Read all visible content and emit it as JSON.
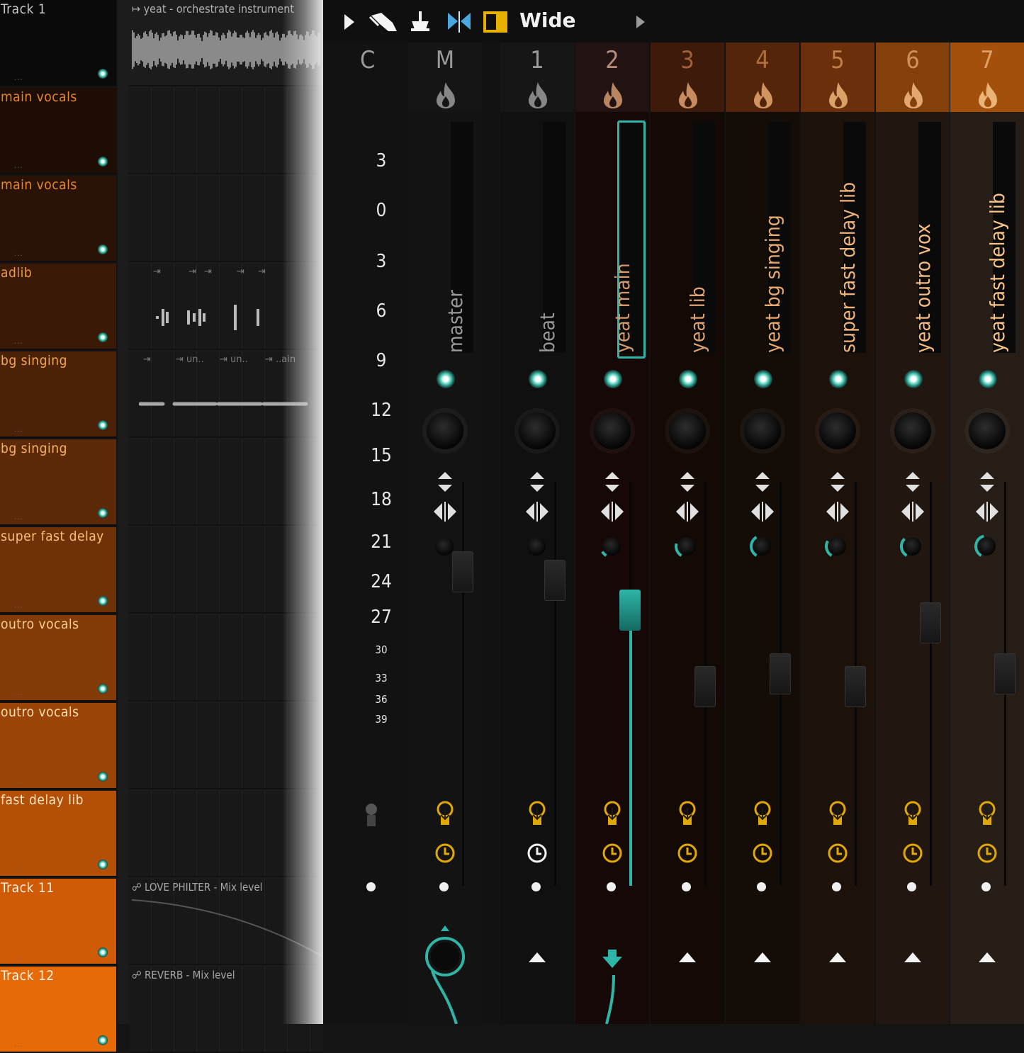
{
  "playlist": {
    "tracks": [
      {
        "label": "Track 1",
        "color": "#0a0a0a",
        "text": "#c8c8c8"
      },
      {
        "label": "main vocals",
        "color": "#1e0d05",
        "text": "#e8862a"
      },
      {
        "label": "main vocals",
        "color": "#2a1306",
        "text": "#e8862a"
      },
      {
        "label": "adlib",
        "color": "#3a1a07",
        "text": "#f09a3c"
      },
      {
        "label": "bg singing",
        "color": "#4b2208",
        "text": "#f5a650"
      },
      {
        "label": "bg singing",
        "color": "#5c2a08",
        "text": "#f7b060"
      },
      {
        "label": "super fast delay",
        "color": "#6f3208",
        "text": "#fbc078"
      },
      {
        "label": "outro vocals",
        "color": "#833b08",
        "text": "#ffd090"
      },
      {
        "label": "outro vocals",
        "color": "#9a4507",
        "text": "#ffe0b0"
      },
      {
        "label": "fast delay lib",
        "color": "#b44f07",
        "text": "#ffe8c8"
      },
      {
        "label": "Track 11",
        "color": "#d05b06",
        "text": "#fff0e0"
      },
      {
        "label": "Track 12",
        "color": "#e66b08",
        "text": "#fff6ec"
      }
    ],
    "track_dots": "...",
    "clip_audio_title": "yeat - orchestrate instrument",
    "clip_adlib_markers": [
      "",
      "",
      "",
      "",
      ""
    ],
    "clip_bg_labels": [
      "un..",
      "un..",
      "..ain"
    ],
    "automation_1": "LOVE PHILTER - Mix level",
    "automation_2": "REVERB - Mix level"
  },
  "toolbar": {
    "view_label": "Wide",
    "icons": [
      "play-arrow-icon",
      "brush-icon",
      "stamp-icon",
      "mirror-icon",
      "panel-icon"
    ],
    "accent": "#e8b000"
  },
  "mixer": {
    "scale": [
      "3",
      "0",
      "3",
      "6",
      "9",
      "12",
      "15",
      "18",
      "21",
      "24",
      "27",
      "30",
      "33",
      "36",
      "39"
    ],
    "current_label": "C",
    "strips": [
      {
        "num": "M",
        "name": "master",
        "bg": "#131313",
        "head": "#151515",
        "num_color": "#9a9a9a",
        "name_color": "#9a9a9a",
        "fader_pos": 0.03,
        "selected": false,
        "send_knob": 0
      },
      {
        "num": "1",
        "name": "beat",
        "bg": "#101010",
        "head": "#161616",
        "num_color": "#9a9a9a",
        "name_color": "#9a9a9a",
        "fader_pos": 0.05,
        "selected": false,
        "send_knob": 0
      },
      {
        "num": "2",
        "name": "yeat main",
        "bg": "#150807",
        "head": "#221312",
        "num_color": "#b48a7a",
        "name_color": "#d39a70",
        "fader_pos": 0.12,
        "selected": true,
        "send_knob": 0.1
      },
      {
        "num": "3",
        "name": "yeat lib",
        "bg": "#130a06",
        "head": "#3d1a0a",
        "num_color": "#a0603a",
        "name_color": "#e0a070",
        "fader_pos": 0.3,
        "selected": false,
        "send_knob": 0.25
      },
      {
        "num": "4",
        "name": "yeat bg singing",
        "bg": "#140c06",
        "head": "#55250b",
        "num_color": "#b06f3a",
        "name_color": "#e8a870",
        "fader_pos": 0.27,
        "selected": false,
        "send_knob": 0.4
      },
      {
        "num": "5",
        "name": "super fast delay lib",
        "bg": "#1d1209",
        "head": "#6b300b",
        "num_color": "#c07e48",
        "name_color": "#f0b47a",
        "fader_pos": 0.3,
        "selected": false,
        "send_knob": 0.3
      },
      {
        "num": "6",
        "name": "yeat outro vox",
        "bg": "#221710",
        "head": "#84400b",
        "num_color": "#d09058",
        "name_color": "#f4ba80",
        "fader_pos": 0.15,
        "selected": false,
        "send_knob": 0.35
      },
      {
        "num": "7",
        "name": "yeat fast delay lib",
        "bg": "#261d16",
        "head": "#a2500c",
        "num_color": "#e0a068",
        "name_color": "#f8c488",
        "fader_pos": 0.27,
        "selected": false,
        "send_knob": 0.45
      }
    ],
    "accent_teal": "#2fb5a8",
    "icon_yellow": "#e0a800"
  }
}
